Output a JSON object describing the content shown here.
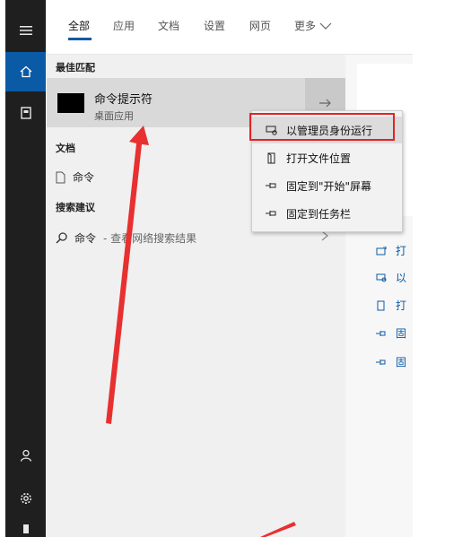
{
  "tabs": [
    {
      "label": "全部"
    },
    {
      "label": "应用"
    },
    {
      "label": "文档"
    },
    {
      "label": "设置"
    },
    {
      "label": "网页"
    },
    {
      "label": "更多"
    }
  ],
  "results": {
    "best_match_header": "最佳匹配",
    "best_match": {
      "title": "命令提示符",
      "subtitle": "桌面应用"
    },
    "documents_header": "文档",
    "document_item": "命令",
    "suggestions_header": "搜索建议",
    "suggestion_query": "命令",
    "suggestion_hint": "- 查看网络搜索结果"
  },
  "context_menu": {
    "items": [
      {
        "label": "以管理员身份运行"
      },
      {
        "label": "打开文件位置"
      },
      {
        "label": "固定到\"开始\"屏幕"
      },
      {
        "label": "固定到任务栏"
      }
    ]
  },
  "preview": {
    "actions": [
      {
        "label": "打"
      },
      {
        "label": "以"
      },
      {
        "label": "打"
      },
      {
        "label": "固"
      },
      {
        "label": "固"
      }
    ]
  },
  "colors": {
    "accent": "#0b5aa6",
    "highlight_border": "#e02424",
    "rail": "#1f1f1f"
  }
}
